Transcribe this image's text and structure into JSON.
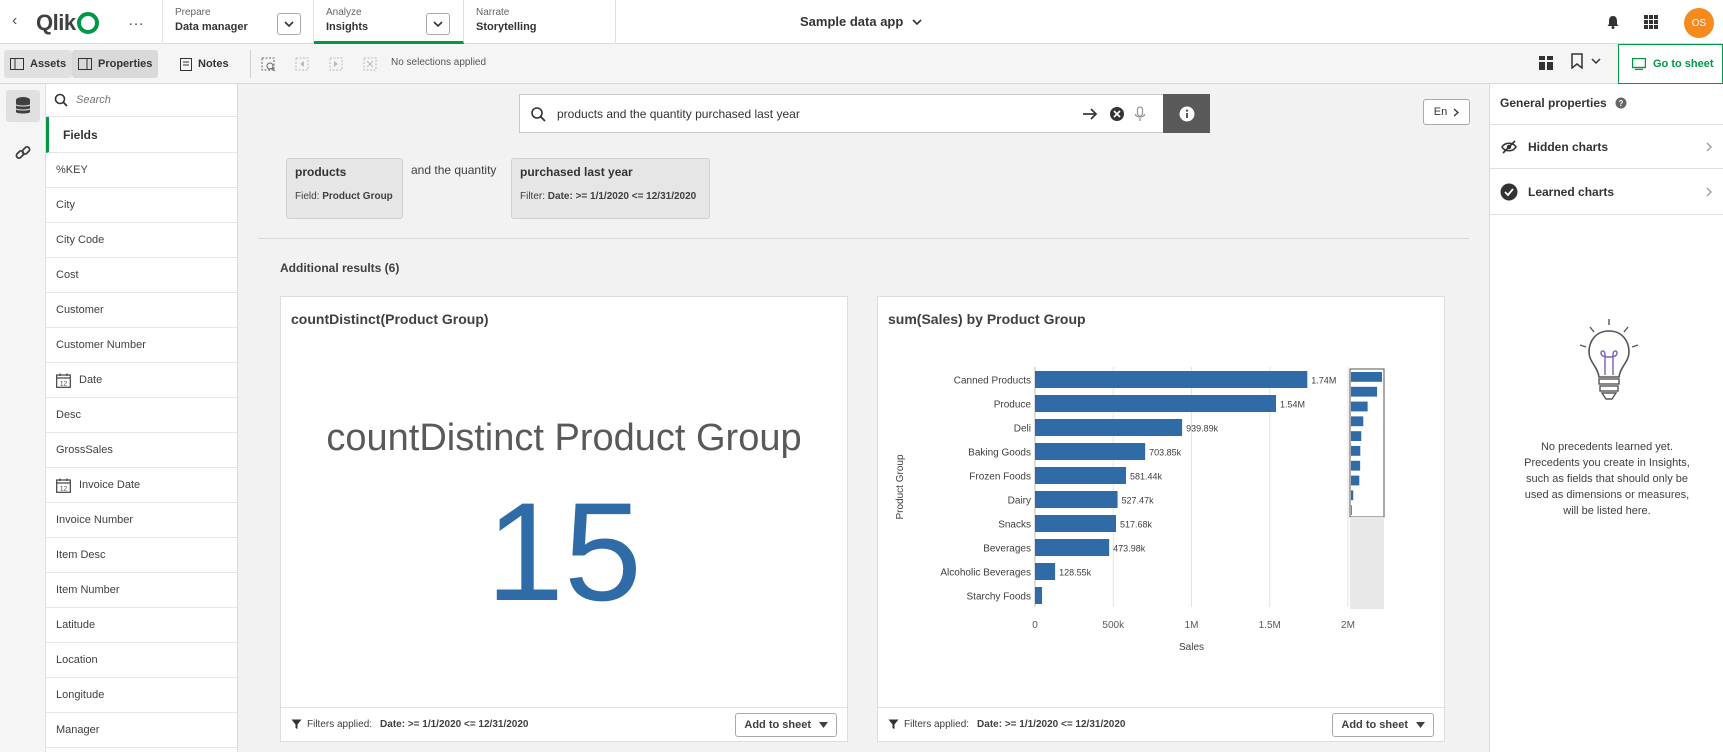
{
  "header": {
    "logo_text": "Qlik",
    "tabs": [
      {
        "small": "Prepare",
        "big": "Data manager"
      },
      {
        "small": "Analyze",
        "big": "Insights"
      },
      {
        "small": "Narrate",
        "big": "Storytelling"
      }
    ],
    "app_title": "Sample data app",
    "avatar_initials": "OS"
  },
  "toolbar": {
    "assets_label": "Assets",
    "properties_label": "Properties",
    "notes_label": "Notes",
    "selections_text": "No selections applied",
    "go_to_sheet_label": "Go to sheet"
  },
  "fields_panel": {
    "search_placeholder": "Search",
    "heading": "Fields",
    "items": [
      {
        "label": "%KEY",
        "calendar": false
      },
      {
        "label": "City",
        "calendar": false
      },
      {
        "label": "City Code",
        "calendar": false
      },
      {
        "label": "Cost",
        "calendar": false
      },
      {
        "label": "Customer",
        "calendar": false
      },
      {
        "label": "Customer Number",
        "calendar": false
      },
      {
        "label": "Date",
        "calendar": true
      },
      {
        "label": "Desc",
        "calendar": false
      },
      {
        "label": "GrossSales",
        "calendar": false
      },
      {
        "label": "Invoice Date",
        "calendar": true
      },
      {
        "label": "Invoice Number",
        "calendar": false
      },
      {
        "label": "Item Desc",
        "calendar": false
      },
      {
        "label": "Item Number",
        "calendar": false
      },
      {
        "label": "Latitude",
        "calendar": false
      },
      {
        "label": "Location",
        "calendar": false
      },
      {
        "label": "Longitude",
        "calendar": false
      },
      {
        "label": "Manager",
        "calendar": false
      }
    ]
  },
  "search": {
    "query": "products and the quantity purchased last year",
    "language": "En"
  },
  "chips": {
    "products_title": "products",
    "products_sub_prefix": "Field:",
    "products_sub_value": "Product Group",
    "connector": "and the quantity",
    "purchased_title": "purchased last year",
    "purchased_sub_prefix": "Filter:",
    "purchased_sub_value": "Date: >= 1/1/2020 <= 12/31/2020"
  },
  "additional_results_label": "Additional results (6)",
  "kpi_card": {
    "title": "countDistinct(Product Group)",
    "kpi_label": "countDistinct Product Group",
    "kpi_value": "15",
    "filters_prefix": "Filters applied:",
    "filters_value": "Date: >= 1/1/2020 <= 12/31/2020",
    "add_button": "Add to sheet"
  },
  "bar_card": {
    "title": "sum(Sales) by Product Group",
    "filters_prefix": "Filters applied:",
    "filters_value": "Date: >= 1/1/2020 <= 12/31/2020",
    "add_button": "Add to sheet"
  },
  "chart_data": {
    "type": "bar",
    "orientation": "horizontal",
    "title": "sum(Sales) by Product Group",
    "xlabel": "Sales",
    "ylabel": "Product Group",
    "categories": [
      "Canned Products",
      "Produce",
      "Deli",
      "Baking Goods",
      "Frozen Foods",
      "Dairy",
      "Snacks",
      "Beverages",
      "Alcoholic Beverages",
      "Starchy Foods"
    ],
    "values": [
      1740000,
      1540000,
      939890,
      703850,
      581440,
      527470,
      517680,
      473980,
      128550,
      45000
    ],
    "data_labels": [
      "1.74M",
      "1.54M",
      "939.89k",
      "703.85k",
      "581.44k",
      "527.47k",
      "517.68k",
      "473.98k",
      "128.55k",
      ""
    ],
    "xlim": [
      0,
      2000000
    ],
    "x_ticks": [
      0,
      500000,
      1000000,
      1500000,
      2000000
    ],
    "x_tick_labels": [
      "0",
      "500k",
      "1M",
      "1.5M",
      "2M"
    ],
    "minichart_values": [
      2200000,
      1850000,
      1180000,
      870000,
      730000,
      660000,
      650000,
      590000,
      160000,
      55000
    ],
    "grid": true,
    "bar_color": "#2f6ca7"
  },
  "right_panel": {
    "general_properties": "General properties",
    "hidden_charts": "Hidden charts",
    "learned_charts": "Learned charts",
    "empty_message": "No precedents learned yet. Precedents you create in Insights, such as fields that should only be used as dimensions or measures, will be listed here."
  },
  "colors": {
    "qlik_green": "#009845",
    "bar_blue": "#2f6ca7",
    "avatar_orange": "#f58a1f"
  }
}
